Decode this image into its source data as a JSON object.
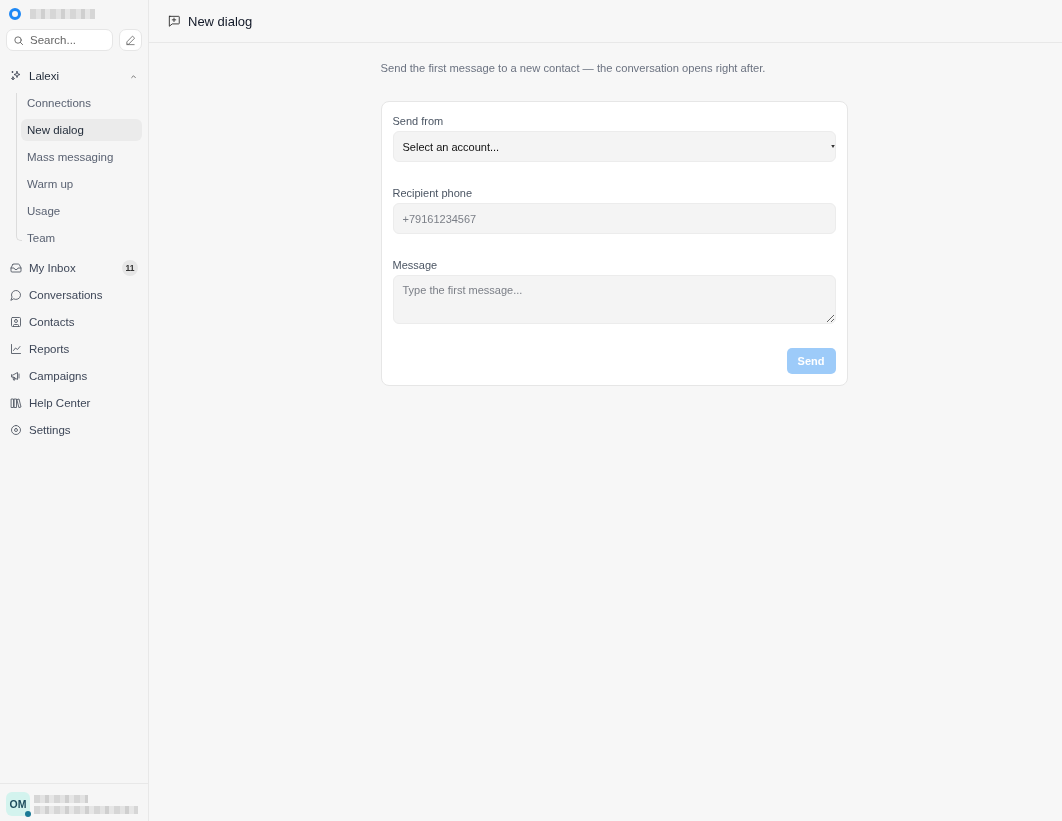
{
  "sidebar": {
    "search": {
      "placeholder": "Search..."
    },
    "group": {
      "label": "Lalexi",
      "expanded": true,
      "children": [
        {
          "label": "Connections",
          "selected": false
        },
        {
          "label": "New dialog",
          "selected": true
        },
        {
          "label": "Mass messaging",
          "selected": false
        },
        {
          "label": "Warm up",
          "selected": false
        },
        {
          "label": "Usage",
          "selected": false
        },
        {
          "label": "Team",
          "selected": false
        }
      ]
    },
    "nav": [
      {
        "label": "My Inbox",
        "badge": "11"
      },
      {
        "label": "Conversations"
      },
      {
        "label": "Contacts"
      },
      {
        "label": "Reports"
      },
      {
        "label": "Campaigns"
      },
      {
        "label": "Help Center"
      },
      {
        "label": "Settings"
      }
    ],
    "user": {
      "initials": "OM",
      "online": true
    }
  },
  "header": {
    "title": "New dialog"
  },
  "intro": "Send the first message to a new contact — the conversation opens right after.",
  "form": {
    "fields": [
      {
        "kind": "select",
        "label": "Send from",
        "value": "Select an account..."
      },
      {
        "kind": "input",
        "label": "Recipient phone",
        "placeholder": "+79161234567"
      },
      {
        "kind": "textarea",
        "label": "Message",
        "placeholder": "Type the first message..."
      }
    ],
    "submit": {
      "label": "Send",
      "disabled": true
    }
  }
}
